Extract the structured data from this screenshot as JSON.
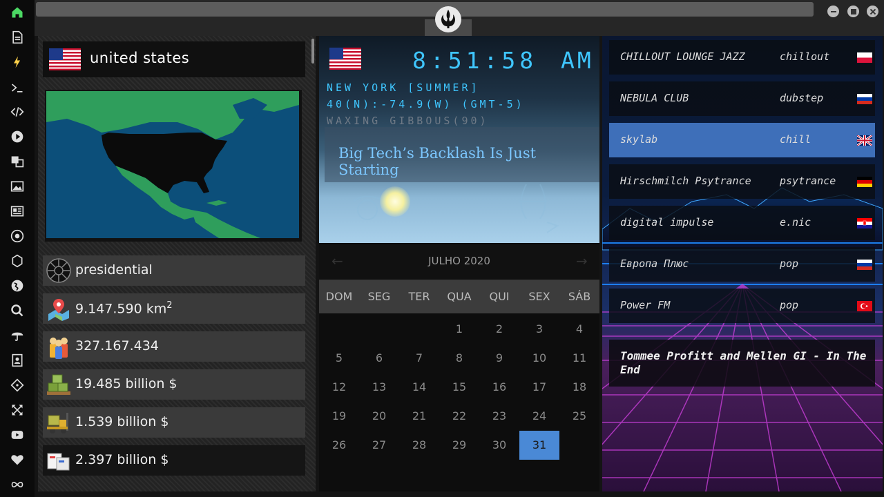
{
  "sidebar": {
    "items": [
      {
        "icon": "home-icon"
      },
      {
        "icon": "document-icon"
      },
      {
        "icon": "bolt-icon"
      },
      {
        "icon": "terminal-icon"
      },
      {
        "icon": "code-icon"
      },
      {
        "icon": "play-icon"
      },
      {
        "icon": "translate-icon"
      },
      {
        "icon": "image-icon"
      },
      {
        "icon": "news-icon"
      },
      {
        "icon": "rebel-icon"
      },
      {
        "icon": "empire-icon"
      },
      {
        "icon": "globe-icon"
      },
      {
        "icon": "search-icon"
      },
      {
        "icon": "umbrella-icon"
      },
      {
        "icon": "contact-icon"
      },
      {
        "icon": "git-icon"
      },
      {
        "icon": "expand-icon"
      },
      {
        "icon": "youtube-icon"
      },
      {
        "icon": "heart-icon"
      },
      {
        "icon": "infinity-icon"
      }
    ],
    "accent_colors": {
      "home": "#4cd964",
      "bolt": "#ffd24a"
    }
  },
  "country": {
    "name": "united states",
    "government": "presidential",
    "area": "9.147.590 km",
    "area_sup": "2",
    "population": "327.167.434",
    "gdp": "19.485 billion $",
    "imports": "1.539 billion $",
    "exports": "2.397 billion $"
  },
  "clock": {
    "time": "8:51:58",
    "ampm": "AM",
    "location": "NEW YORK [SUMMER]",
    "coords": "40(N):-74.9(W) (GMT-5)",
    "moon": "WAXING GIBBOUS(90)",
    "headline": "Big Tech’s Backlash Is Just Starting"
  },
  "calendar": {
    "title": "JULHO 2020",
    "weekdays": [
      "DOM",
      "SEG",
      "TER",
      "QUA",
      "QUI",
      "SEX",
      "SÁB"
    ],
    "first_weekday_index": 3,
    "days_in_month": 31,
    "selected": 31
  },
  "radio": {
    "stations": [
      {
        "name": "CHILLOUT LOUNGE JAZZ",
        "genre": "chillout",
        "flag": "poland",
        "active": false
      },
      {
        "name": "NEBULA CLUB",
        "genre": "dubstep",
        "flag": "russia",
        "active": false
      },
      {
        "name": "skylab",
        "genre": "chill",
        "flag": "uk",
        "active": true
      },
      {
        "name": "Hirschmilch Psytrance",
        "genre": "psytrance",
        "flag": "germany",
        "active": false
      },
      {
        "name": "digital impulse",
        "genre": "e.nic",
        "flag": "croatia",
        "active": false
      },
      {
        "name": "Европа Плюс",
        "genre": "pop",
        "flag": "russia",
        "active": false
      },
      {
        "name": "Power FM",
        "genre": "pop",
        "flag": "turkey",
        "active": false
      }
    ],
    "now_playing": "Tommee Profitt and Mellen GI - In The End"
  }
}
